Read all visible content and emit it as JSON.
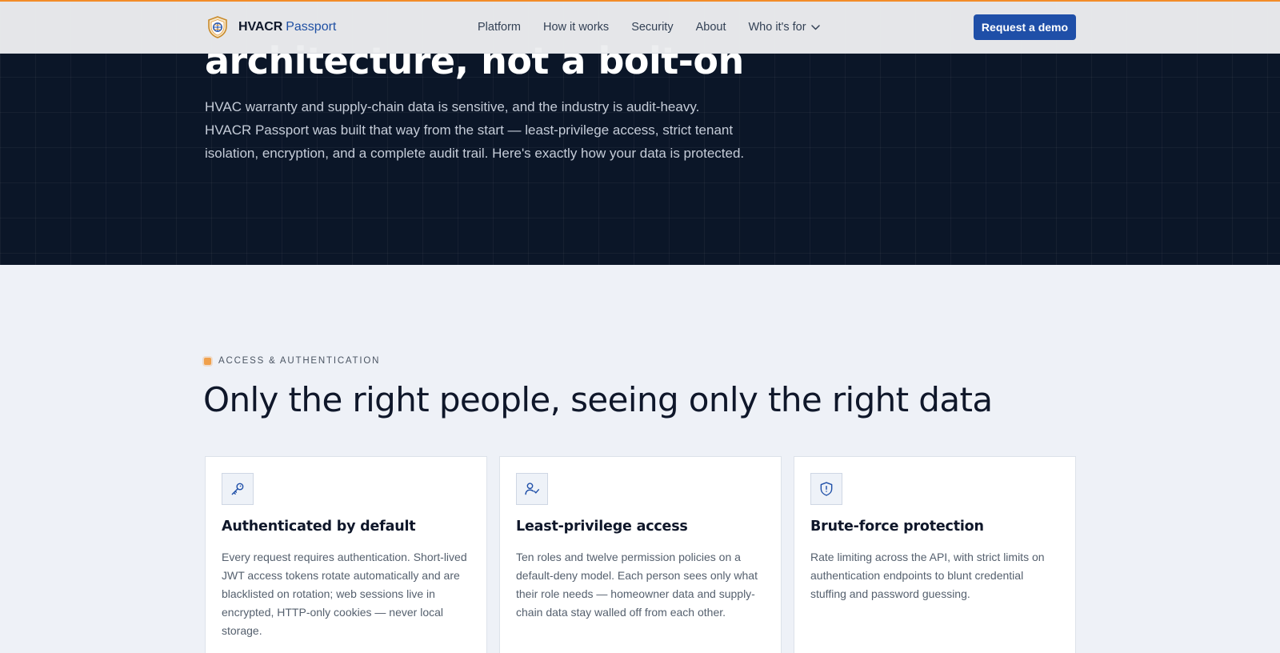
{
  "header": {
    "brand": {
      "name": "HVACR",
      "accent": "Passport"
    },
    "nav": [
      {
        "label": "Platform"
      },
      {
        "label": "How it works"
      },
      {
        "label": "Security"
      },
      {
        "label": "About"
      },
      {
        "label": "Who it's for"
      }
    ],
    "cta_label": "Request a demo"
  },
  "hero": {
    "title_visible": "architecture, not a bolt-on",
    "description": "HVAC warranty and supply-chain data is sensitive, and the industry is audit-heavy. HVACR Passport was built that way from the start — least-privilege access, strict tenant isolation, encryption, and a complete audit trail. Here's exactly how your data is protected."
  },
  "section": {
    "eyebrow": "ACCESS & AUTHENTICATION",
    "title": "Only the right people, seeing only the right data",
    "cards": [
      {
        "icon": "key-icon",
        "title": "Authenticated by default",
        "text": "Every request requires authentication. Short-lived JWT access tokens rotate automatically and are blacklisted on rotation; web sessions live in encrypted, HTTP-only cookies — never local storage."
      },
      {
        "icon": "user-check-icon",
        "title": "Least-privilege access",
        "text": "Ten roles and twelve permission policies on a default-deny model. Each person sees only what their role needs — homeowner data and supply-chain data stay walled off from each other."
      },
      {
        "icon": "shield-alert-icon",
        "title": "Brute-force protection",
        "text": "Rate limiting across the API, with strict limits on authentication endpoints to blunt credential stuffing and password guessing."
      }
    ]
  },
  "colors": {
    "accent_orange": "#f28c28",
    "primary_blue": "#1f4fa8",
    "hero_bg": "#0b1628",
    "section_bg": "#eef1f7"
  }
}
